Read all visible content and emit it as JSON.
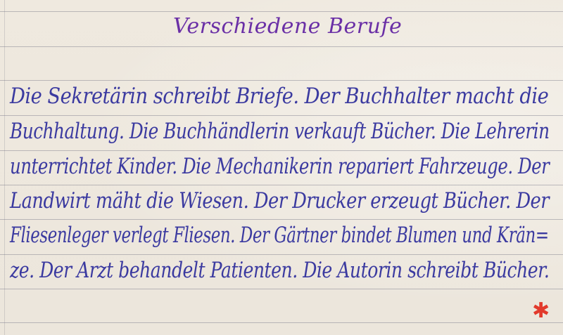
{
  "title": "Verschiedene Berufe",
  "lines": [
    "Die Sekretärin schreibt Briefe. Der Buchhalter macht die",
    "Buchhaltung. Die Buchhändlerin verkauft Bücher. Die Lehrerin",
    "unterrichtet Kinder. Die Mechanikerin repariert Fahrzeuge. Der",
    "Landwirt mäht die Wiesen. Der Drucker erzeugt Bücher. Der",
    "Fliesenleger verlegt Fliesen. Der Gärtner bindet Blumen und Krän=",
    "ze. Der Arzt behandelt Patienten. Die Autorin schreibt Bücher."
  ],
  "mark": "✱",
  "colors": {
    "title_ink": "#6a2fa6",
    "body_ink": "#3b3aa0",
    "mark_ink": "#e23a2c",
    "paper": "#efe9df",
    "rule": "#8a8a98"
  }
}
